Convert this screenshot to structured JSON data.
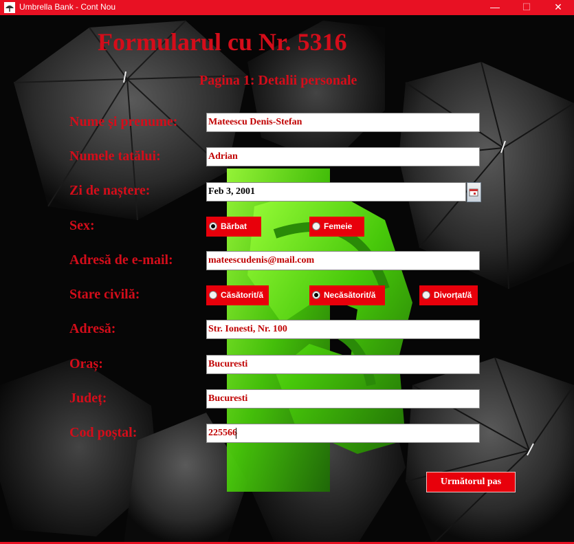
{
  "window": {
    "title": "Umbrella Bank - Cont Nou",
    "controls": {
      "minimize": "—",
      "maximize": "☐",
      "close": "✕"
    },
    "accent_color": "#e81123"
  },
  "form": {
    "title": "Formularul cu Nr. 5316",
    "page_subtitle": "Pagina 1: Detalii personale",
    "fields": {
      "full_name": {
        "label": "Nume și prenume:",
        "value": "Mateescu Denis-Stefan"
      },
      "father_name": {
        "label": "Numele tatălui:",
        "value": "Adrian"
      },
      "birth_date": {
        "label": "Zi de naștere:",
        "value": "Feb 3, 2001",
        "icon": "calendar-icon"
      },
      "sex": {
        "label": "Sex:",
        "options": [
          "Bărbat",
          "Femeie"
        ],
        "selected": "Bărbat"
      },
      "email": {
        "label": "Adresă de e-mail:",
        "value": "mateescudenis@mail.com"
      },
      "civil_status": {
        "label": "Stare civilă:",
        "options": [
          "Căsătorit/ă",
          "Necăsătorit/ă",
          "Divorțat/ă"
        ],
        "selected": "Necăsătorit/ă"
      },
      "address": {
        "label": "Adresă:",
        "value": "Str. Ionesti, Nr. 100"
      },
      "city": {
        "label": "Oraș:",
        "value": "Bucuresti"
      },
      "county": {
        "label": "Județ:",
        "value": "Bucuresti"
      },
      "postal_code": {
        "label": "Cod poștal:",
        "value": "225566"
      }
    },
    "next_button": "Următorul pas"
  },
  "colors": {
    "label_red": "#d40d1a",
    "input_text_red": "#c00000",
    "radio_bg": "#e8000b",
    "dollar_green": "#4cd80a"
  }
}
